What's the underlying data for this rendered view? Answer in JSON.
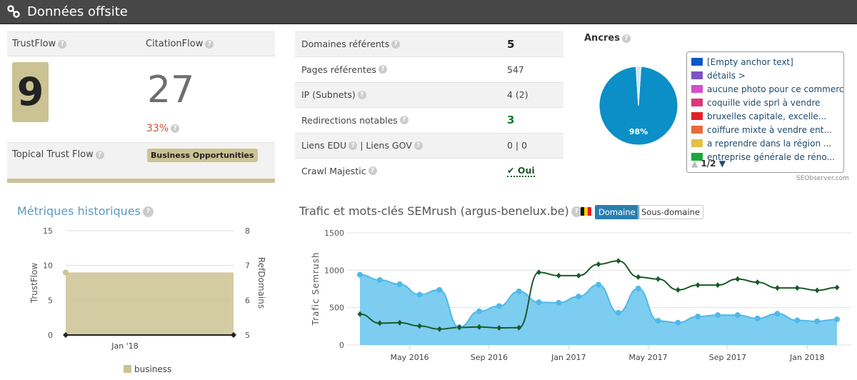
{
  "header": {
    "title": "Données offsite",
    "icon": "link-icon"
  },
  "metrics": {
    "trustflow_label": "TrustFlow",
    "citationflow_label": "CitationFlow",
    "trustflow": "9",
    "citationflow": "27",
    "ratio": "33%",
    "topical_label": "Topical Trust Flow",
    "topical_value": "Business Opportunities",
    "topical_color": "#cbc393"
  },
  "stats": [
    {
      "label": "Domaines référents",
      "value": "5"
    },
    {
      "label": "Pages référentes",
      "value": "547"
    },
    {
      "label": "IP (Subnets)",
      "value": "4 (2)"
    },
    {
      "label": "Redirections notables",
      "value": "3"
    },
    {
      "label": "Liens EDU",
      "label2": "Liens GOV",
      "value": "0 | 0"
    },
    {
      "label": "Crawl Majestic",
      "value": "Oui"
    }
  ],
  "anchors": {
    "title": "Ancres",
    "pie_label": "98%",
    "pie_value": 98,
    "pager": "1/2",
    "credit": "SEObserver.com",
    "items": [
      {
        "label": "[Empty anchor text]",
        "color": "#0a57c9"
      },
      {
        "label": "détails >",
        "color": "#7b55c6"
      },
      {
        "label": "aucune photo pour ce commerce",
        "color": "#d24fc8"
      },
      {
        "label": "coquille vide sprl à vendre",
        "color": "#e0357a"
      },
      {
        "label": "bruxelles capitale, excelle...",
        "color": "#e51f28"
      },
      {
        "label": "coiffure mixte à vendre ent...",
        "color": "#e66a3c"
      },
      {
        "label": "a reprendre dans la région ...",
        "color": "#e2c04a"
      },
      {
        "label": "entreprise générale de réno...",
        "color": "#1aa83c"
      }
    ]
  },
  "chart_data": [
    {
      "type": "area",
      "title": "Métriques historiques",
      "ylabel": "TrustFlow",
      "y2label": "RefDomains",
      "ylim": [
        0,
        15
      ],
      "y2lim": [
        5,
        8
      ],
      "yticks": [
        "0",
        "5",
        "10",
        "15"
      ],
      "y2ticks": [
        "5",
        "6",
        "7",
        "8"
      ],
      "xticks": [
        "Jan '18"
      ],
      "legend": [
        "business"
      ],
      "legend_position": "bottom",
      "grid": true,
      "series": [
        {
          "name": "business",
          "values": [
            9,
            9
          ],
          "color": "#cbc393"
        },
        {
          "values": [
            5,
            5
          ],
          "axis": "right",
          "color": "#222"
        }
      ]
    },
    {
      "type": "area+line",
      "title": "Trafic et mots-clés SEMrush (argus-benelux.be)",
      "ylabel": "Trafic Semrush",
      "ylim": [
        0,
        1500
      ],
      "yticks": [
        "0",
        "500",
        "1000",
        "1500"
      ],
      "grid": true,
      "xticks": [
        "May 2016",
        "Sep 2016",
        "Jan 2017",
        "May 2017",
        "Sep 2017",
        "Jan 2018"
      ],
      "x": [
        "2016-02",
        "2016-03",
        "2016-04",
        "2016-05",
        "2016-06",
        "2016-07",
        "2016-08",
        "2016-09",
        "2016-10",
        "2016-11",
        "2016-12",
        "2017-01",
        "2017-02",
        "2017-03",
        "2017-04",
        "2017-05",
        "2017-06",
        "2017-07",
        "2017-08",
        "2017-09",
        "2017-10",
        "2017-11",
        "2017-12",
        "2018-01",
        "2018-02"
      ],
      "series": [
        {
          "values": [
            940,
            870,
            813,
            674,
            737,
            238,
            451,
            521,
            718,
            572,
            566,
            648,
            807,
            432,
            756,
            324,
            299,
            381,
            400,
            400,
            356,
            419,
            330,
            318,
            343
          ],
          "color": "#4fb9e9"
        },
        {
          "values": [
            413,
            292,
            299,
            254,
            213,
            235,
            241,
            229,
            232,
            972,
            928,
            928,
            1080,
            1125,
            909,
            883,
            737,
            801,
            801,
            883,
            839,
            763,
            763,
            731,
            769
          ],
          "color": "#1a5a2a"
        }
      ]
    }
  ],
  "semrush": {
    "tab_domain": "Domaine",
    "tab_subdomain": "Sous-domaine"
  }
}
